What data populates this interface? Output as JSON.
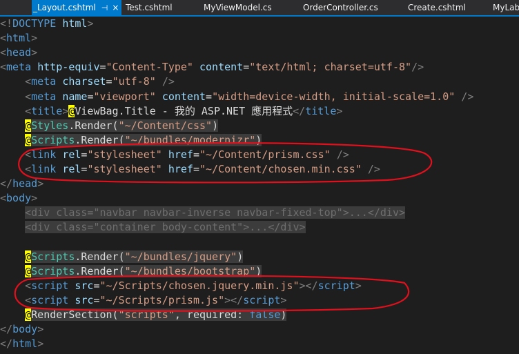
{
  "tabs": [
    {
      "label": "_Layout.cshtml",
      "active": true
    },
    {
      "label": "Test.cshtml"
    },
    {
      "label": "MyViewModel.cs"
    },
    {
      "label": "OrderController.cs"
    },
    {
      "label": "Create.cshtml"
    },
    {
      "label": "MyLab"
    }
  ],
  "tab_pin": "⊣",
  "tab_close": "×",
  "lines": [
    {
      "seg": [
        {
          "c": "del",
          "t": "<!"
        },
        {
          "c": "tag",
          "t": "DOCTYPE"
        },
        {
          "c": "txt",
          "t": " "
        },
        {
          "c": "attr",
          "t": "html"
        },
        {
          "c": "del",
          "t": ">"
        }
      ]
    },
    {
      "seg": [
        {
          "c": "del",
          "t": "<"
        },
        {
          "c": "tag",
          "t": "html"
        },
        {
          "c": "del",
          "t": ">"
        }
      ]
    },
    {
      "seg": [
        {
          "c": "del",
          "t": "<"
        },
        {
          "c": "tag",
          "t": "head"
        },
        {
          "c": "del",
          "t": ">"
        }
      ]
    },
    {
      "seg": [
        {
          "c": "del",
          "t": "<"
        },
        {
          "c": "tag",
          "t": "meta"
        },
        {
          "c": "txt",
          "t": " "
        },
        {
          "c": "attr",
          "t": "http-equiv"
        },
        {
          "c": "txt",
          "t": "="
        },
        {
          "c": "str",
          "t": "\"Content-Type\""
        },
        {
          "c": "txt",
          "t": " "
        },
        {
          "c": "attr",
          "t": "content"
        },
        {
          "c": "txt",
          "t": "="
        },
        {
          "c": "str",
          "t": "\"text/html; charset=utf-8\""
        },
        {
          "c": "del",
          "t": "/>"
        }
      ]
    },
    {
      "seg": [
        {
          "c": "txt",
          "t": "    "
        },
        {
          "c": "del",
          "t": "<"
        },
        {
          "c": "tag",
          "t": "meta"
        },
        {
          "c": "txt",
          "t": " "
        },
        {
          "c": "attr",
          "t": "charset"
        },
        {
          "c": "txt",
          "t": "="
        },
        {
          "c": "str",
          "t": "\"utf-8\""
        },
        {
          "c": "txt",
          "t": " "
        },
        {
          "c": "del",
          "t": "/>"
        }
      ]
    },
    {
      "seg": [
        {
          "c": "txt",
          "t": "    "
        },
        {
          "c": "del",
          "t": "<"
        },
        {
          "c": "tag",
          "t": "meta"
        },
        {
          "c": "txt",
          "t": " "
        },
        {
          "c": "attr",
          "t": "name"
        },
        {
          "c": "txt",
          "t": "="
        },
        {
          "c": "str",
          "t": "\"viewport\""
        },
        {
          "c": "txt",
          "t": " "
        },
        {
          "c": "attr",
          "t": "content"
        },
        {
          "c": "txt",
          "t": "="
        },
        {
          "c": "str",
          "t": "\"width=device-width, initial-scale=1.0\""
        },
        {
          "c": "txt",
          "t": " "
        },
        {
          "c": "del",
          "t": "/>"
        }
      ]
    },
    {
      "seg": [
        {
          "c": "txt",
          "t": "    "
        },
        {
          "c": "del",
          "t": "<"
        },
        {
          "c": "tag",
          "t": "title"
        },
        {
          "c": "del",
          "t": ">"
        },
        {
          "c": "razor",
          "t": "@"
        },
        {
          "c": "txt",
          "t": "ViewBag.Title - 我的 ASP.NET 應用程式"
        },
        {
          "c": "del",
          "t": "</"
        },
        {
          "c": "tag",
          "t": "title"
        },
        {
          "c": "del",
          "t": ">"
        }
      ]
    },
    {
      "seg": [
        {
          "c": "txt",
          "t": "    "
        },
        {
          "c": "razor",
          "t": "@"
        },
        {
          "c": "cls hl",
          "t": "Styles"
        },
        {
          "c": "txt hl",
          "t": ".Render("
        },
        {
          "c": "str hl",
          "t": "\"~/Content/css\""
        },
        {
          "c": "txt hl",
          "t": ")"
        }
      ]
    },
    {
      "seg": [
        {
          "c": "txt",
          "t": "    "
        },
        {
          "c": "razor",
          "t": "@"
        },
        {
          "c": "cls hl",
          "t": "Scripts"
        },
        {
          "c": "txt hl",
          "t": ".Render("
        },
        {
          "c": "str hl",
          "t": "\"~/bundles/modernizr\""
        },
        {
          "c": "txt hl",
          "t": ")"
        }
      ]
    },
    {
      "seg": [
        {
          "c": "txt",
          "t": "    "
        },
        {
          "c": "del",
          "t": "<"
        },
        {
          "c": "tag",
          "t": "link"
        },
        {
          "c": "txt",
          "t": " "
        },
        {
          "c": "attr",
          "t": "rel"
        },
        {
          "c": "txt",
          "t": "="
        },
        {
          "c": "str",
          "t": "\"stylesheet\""
        },
        {
          "c": "txt",
          "t": " "
        },
        {
          "c": "attr",
          "t": "href"
        },
        {
          "c": "txt",
          "t": "="
        },
        {
          "c": "str",
          "t": "\"~/Content/prism.css\""
        },
        {
          "c": "txt",
          "t": " "
        },
        {
          "c": "del",
          "t": "/>"
        }
      ]
    },
    {
      "seg": [
        {
          "c": "txt",
          "t": "    "
        },
        {
          "c": "del",
          "t": "<"
        },
        {
          "c": "tag",
          "t": "link"
        },
        {
          "c": "txt",
          "t": " "
        },
        {
          "c": "attr",
          "t": "rel"
        },
        {
          "c": "txt",
          "t": "="
        },
        {
          "c": "str",
          "t": "\"stylesheet\""
        },
        {
          "c": "txt",
          "t": " "
        },
        {
          "c": "attr",
          "t": "href"
        },
        {
          "c": "txt",
          "t": "="
        },
        {
          "c": "str",
          "t": "\"~/Content/chosen.min.css\""
        },
        {
          "c": "txt",
          "t": " "
        },
        {
          "c": "del",
          "t": "/>"
        }
      ]
    },
    {
      "seg": [
        {
          "c": "del",
          "t": "</"
        },
        {
          "c": "tag",
          "t": "head"
        },
        {
          "c": "del",
          "t": ">"
        }
      ]
    },
    {
      "seg": [
        {
          "c": "del",
          "t": "<"
        },
        {
          "c": "tag",
          "t": "body"
        },
        {
          "c": "del",
          "t": ">"
        }
      ]
    },
    {
      "seg": [
        {
          "c": "txt",
          "t": "    "
        },
        {
          "c": "fade hl",
          "t": "<div class=\"navbar navbar-inverse navbar-fixed-top\">...</div>"
        }
      ]
    },
    {
      "seg": [
        {
          "c": "txt",
          "t": "    "
        },
        {
          "c": "fade hl",
          "t": "<div class=\"container body-content\">...</div>"
        }
      ]
    },
    {
      "seg": [
        {
          "c": "txt",
          "t": ""
        }
      ]
    },
    {
      "seg": [
        {
          "c": "txt",
          "t": "    "
        },
        {
          "c": "razor",
          "t": "@"
        },
        {
          "c": "cls hl",
          "t": "Scripts"
        },
        {
          "c": "txt hl",
          "t": ".Render("
        },
        {
          "c": "str hl",
          "t": "\"~/bundles/jquery\""
        },
        {
          "c": "txt hl",
          "t": ")"
        }
      ]
    },
    {
      "seg": [
        {
          "c": "txt",
          "t": "    "
        },
        {
          "c": "razor",
          "t": "@"
        },
        {
          "c": "cls hl",
          "t": "Scripts"
        },
        {
          "c": "txt hl",
          "t": ".Render("
        },
        {
          "c": "str hl",
          "t": "\"~/bundles/bootstrap\""
        },
        {
          "c": "txt hl",
          "t": ")"
        }
      ]
    },
    {
      "seg": [
        {
          "c": "txt",
          "t": "    "
        },
        {
          "c": "del",
          "t": "<"
        },
        {
          "c": "tag",
          "t": "script"
        },
        {
          "c": "txt",
          "t": " "
        },
        {
          "c": "attr",
          "t": "src"
        },
        {
          "c": "txt",
          "t": "="
        },
        {
          "c": "str",
          "t": "\"~/Scripts/chosen.jquery.min.js\""
        },
        {
          "c": "del",
          "t": "></"
        },
        {
          "c": "tag",
          "t": "script"
        },
        {
          "c": "del",
          "t": ">"
        }
      ]
    },
    {
      "seg": [
        {
          "c": "txt",
          "t": "    "
        },
        {
          "c": "del",
          "t": "<"
        },
        {
          "c": "tag",
          "t": "script"
        },
        {
          "c": "txt",
          "t": " "
        },
        {
          "c": "attr",
          "t": "src"
        },
        {
          "c": "txt",
          "t": "="
        },
        {
          "c": "str",
          "t": "\"~/Scripts/prism.js\""
        },
        {
          "c": "del",
          "t": "></"
        },
        {
          "c": "tag",
          "t": "script"
        },
        {
          "c": "del",
          "t": ">"
        }
      ]
    },
    {
      "seg": [
        {
          "c": "txt",
          "t": "    "
        },
        {
          "c": "razor",
          "t": "@"
        },
        {
          "c": "txt hl",
          "t": "RenderSection("
        },
        {
          "c": "str hl",
          "t": "\"scripts\""
        },
        {
          "c": "txt hl",
          "t": ", required: "
        },
        {
          "c": "kw hl",
          "t": "false"
        },
        {
          "c": "txt hl",
          "t": ")"
        }
      ]
    },
    {
      "seg": [
        {
          "c": "del",
          "t": "</"
        },
        {
          "c": "tag",
          "t": "body"
        },
        {
          "c": "del",
          "t": ">"
        }
      ]
    },
    {
      "seg": [
        {
          "c": "del",
          "t": "</"
        },
        {
          "c": "tag",
          "t": "html"
        },
        {
          "c": "del",
          "t": ">"
        }
      ]
    }
  ],
  "colors": {
    "annotation": "#e0101c",
    "accent": "#007acc"
  }
}
